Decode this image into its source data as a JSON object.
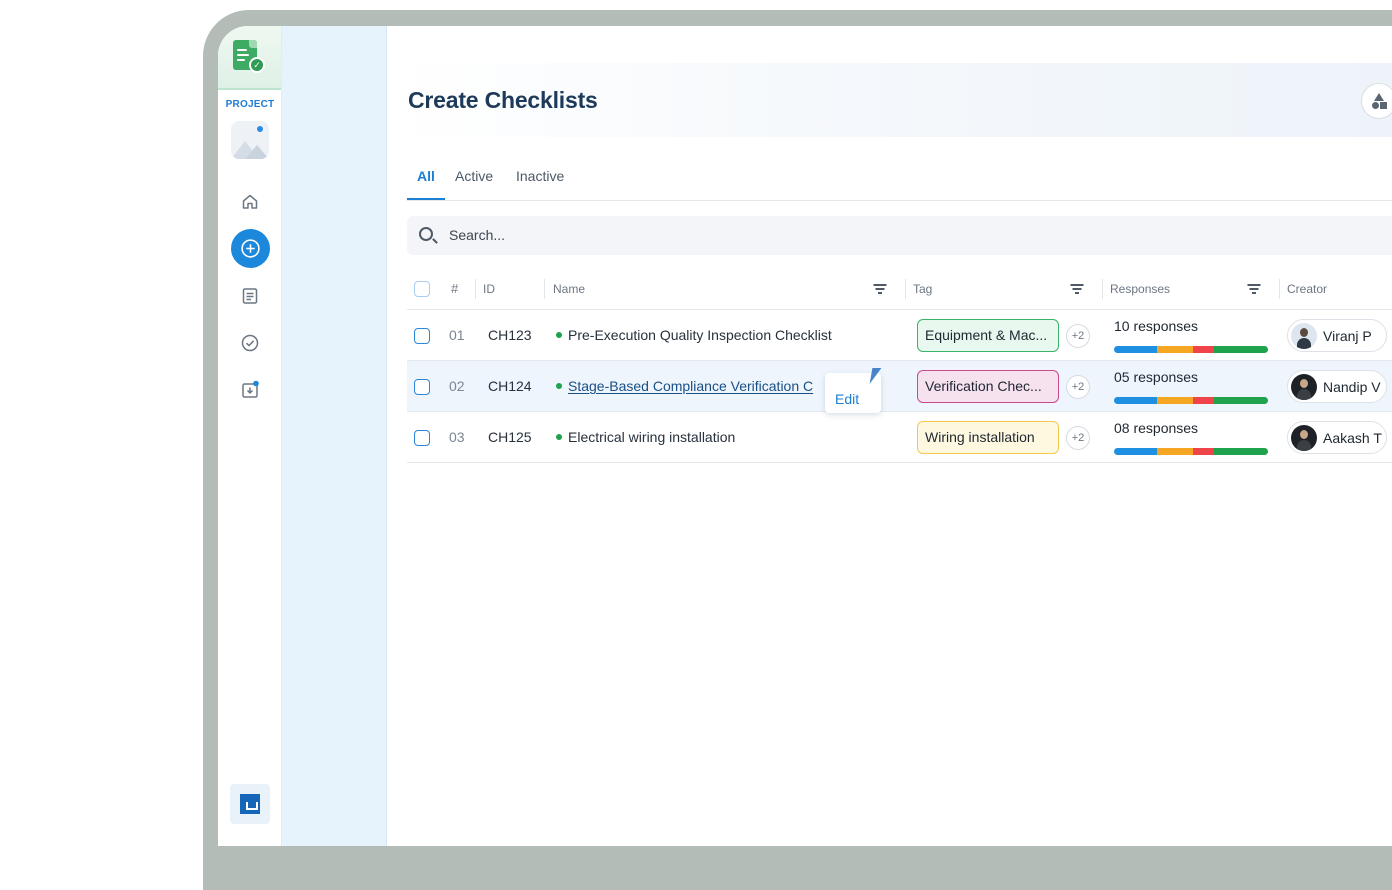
{
  "app": {
    "section_label": "PROJECT"
  },
  "header": {
    "title": "Create Checklists"
  },
  "tabs": [
    {
      "label": "All",
      "active": true
    },
    {
      "label": "Active",
      "active": false
    },
    {
      "label": "Inactive",
      "active": false
    }
  ],
  "search": {
    "placeholder": "Search..."
  },
  "table": {
    "columns": {
      "num": "#",
      "id": "ID",
      "name": "Name",
      "tag": "Tag",
      "responses": "Responses",
      "creator": "Creator"
    },
    "rows": [
      {
        "num": "01",
        "id": "CH123",
        "name": "Pre-Execution Quality Inspection Checklist",
        "tag": "Equipment & Mac...",
        "tag_color": "#39b26a",
        "tag_extra": "+2",
        "responses": "10 responses",
        "creator": "Viranj P",
        "highlighted": false
      },
      {
        "num": "02",
        "id": "CH124",
        "name": "Stage-Based Compliance Verification C",
        "tag": "Verification Chec...",
        "tag_color": "#c94a8d",
        "tag_extra": "+2",
        "responses": "05 responses",
        "creator": "Nandip V",
        "highlighted": true
      },
      {
        "num": "03",
        "id": "CH125",
        "name": "Electrical wiring installation",
        "tag": "Wiring installation",
        "tag_color": "#f0c94d",
        "tag_extra": "+2",
        "responses": "08 responses",
        "creator": "Aakash T",
        "highlighted": false
      }
    ]
  },
  "row_action": {
    "label": "Edit"
  },
  "colors": {
    "accent": "#1b7fd4",
    "title": "#1d3a5a",
    "status_active": "#1fa24c",
    "bar_segments": [
      "#1e8fe1",
      "#f5a623",
      "#f0444b",
      "#1fa24c"
    ]
  },
  "icons": {
    "rail": [
      "checklist-logo-icon",
      "image-placeholder-icon",
      "home-icon",
      "add-circle-icon",
      "document-icon",
      "check-circle-icon",
      "download-box-icon",
      "brand-logo-icon"
    ],
    "header": "shapes-icon",
    "search": "search-icon",
    "filter": "filter-icon"
  }
}
